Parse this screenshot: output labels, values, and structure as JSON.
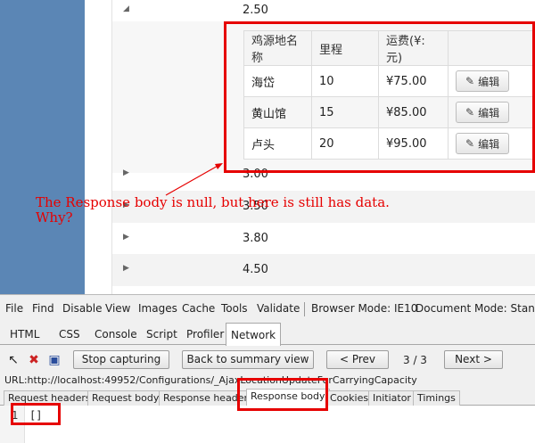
{
  "grid": {
    "rows": [
      {
        "value": "2.50",
        "expanded": true
      },
      {
        "value": "3.00",
        "expanded": false
      },
      {
        "value": "3.80",
        "expanded": false
      },
      {
        "value": "4.50",
        "expanded": false
      }
    ],
    "row_value_hidden": "3.50"
  },
  "detail": {
    "headers": [
      "鸡源地名称",
      "里程",
      "运费(¥:元)",
      ""
    ],
    "rows": [
      {
        "name": "海岱",
        "distance": "10",
        "fee": "¥75.00"
      },
      {
        "name": "黄山馆",
        "distance": "15",
        "fee": "¥85.00"
      },
      {
        "name": "卢头",
        "distance": "20",
        "fee": "¥95.00"
      }
    ],
    "edit_label": "编辑"
  },
  "annotation": {
    "line1": "The Response body is null, but here is still has data.",
    "line2": "Why?",
    "color": "#e60000"
  },
  "devtools": {
    "menu": [
      "File",
      "Find",
      "Disable",
      "View",
      "Images",
      "Cache",
      "Tools",
      "Validate",
      "Browser Mode: IE10",
      "Document Mode: Standa"
    ],
    "tabs": [
      "HTML",
      "CSS",
      "Console",
      "Script",
      "Profiler",
      "Network"
    ],
    "active_tab": "Network",
    "toolbar": {
      "stop_capturing": "Stop capturing",
      "back_to_summary": "Back to summary view",
      "prev": "< Prev",
      "page": "3 / 3",
      "next": "Next >"
    },
    "url": "URL:http://localhost:49952/Configurations/_AjaxLocationUpdateForCarryingCapacity",
    "detail_tabs": [
      "Request headers",
      "Request body",
      "Response headers",
      "Response body",
      "Cookies",
      "Initiator",
      "Timings"
    ],
    "active_detail_tab": "Response body",
    "response_body": {
      "line_number": "1",
      "content": "[]"
    }
  },
  "icons": {
    "expand": "caret-right-icon",
    "collapse": "caret-down-icon",
    "edit": "pencil-icon",
    "select_element": "cursor-icon",
    "clear": "clear-icon",
    "save": "save-icon"
  }
}
